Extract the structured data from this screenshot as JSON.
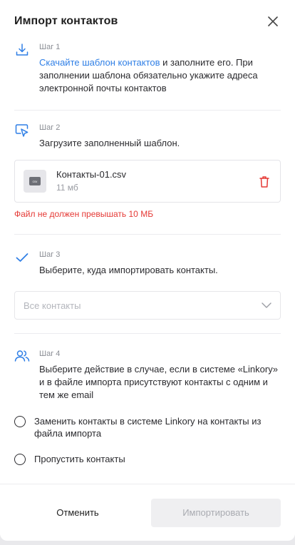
{
  "dialog": {
    "title": "Импорт контактов"
  },
  "step1": {
    "label": "Шаг 1",
    "link_text": "Скачайте шаблон контактов",
    "text": " и заполните его.  При заполнении шаблона обязательно укажите адреса электронной почты контактов"
  },
  "step2": {
    "label": "Шаг 2",
    "text": "Загрузите заполненный шаблон.",
    "file": {
      "thumb_text": "csv",
      "name": "Контакты-01.csv",
      "size": "11 мб"
    },
    "error": "Файл не должен превышать 10 МБ"
  },
  "step3": {
    "label": "Шаг 3",
    "text": "Выберите, куда импортировать контакты.",
    "select_placeholder": "Все контакты"
  },
  "step4": {
    "label": "Шаг 4",
    "text": "Выберите действие в случае, если в системе «Linkory» и в файле импорта присутствуют контакты с одним и тем же email",
    "options": [
      {
        "label": "Заменить контакты в системе Linkory на контакты из файла импорта"
      },
      {
        "label": "Пропустить контакты"
      }
    ]
  },
  "footer": {
    "cancel_label": "Отменить",
    "import_label": "Импортировать"
  },
  "colors": {
    "accent": "#2f7fe6",
    "error": "#e53935",
    "text": "#2b2b2f",
    "muted": "#8a8d94"
  },
  "icons": {
    "close": "close-icon",
    "step1": "download-icon",
    "step2": "cursor-select-icon",
    "step3": "checkmark-icon",
    "step4": "users-icon",
    "delete": "trash-icon",
    "select": "chevron-down-icon"
  }
}
